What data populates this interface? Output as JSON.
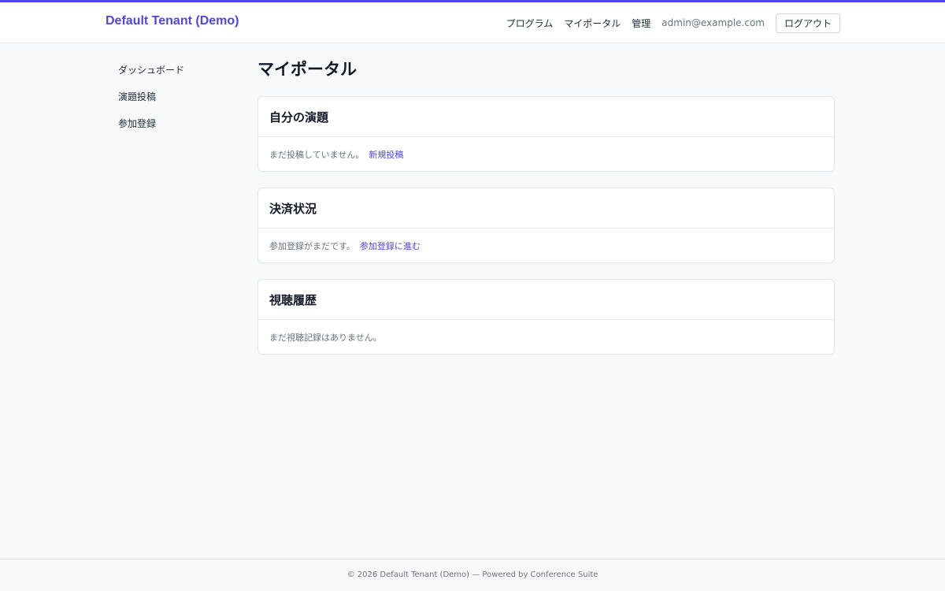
{
  "header": {
    "brand": "Default Tenant (Demo)",
    "nav": {
      "program": "プログラム",
      "my_portal": "マイポータル",
      "admin": "管理"
    },
    "user_email": "admin@example.com",
    "logout_label": "ログアウト",
    "accent_color": "#4f46e5"
  },
  "sidebar": {
    "items": [
      {
        "label": "ダッシュボード"
      },
      {
        "label": "演題投稿"
      },
      {
        "label": "参加登録"
      }
    ]
  },
  "main": {
    "title": "マイポータル",
    "cards": [
      {
        "title": "自分の演題",
        "text": "まだ投稿していません。",
        "link": "新規投稿"
      },
      {
        "title": "決済状況",
        "text": "参加登録がまだです。",
        "link": "参加登録に進む"
      },
      {
        "title": "視聴履歴",
        "text": "まだ視聴記録はありません。"
      }
    ]
  },
  "footer": {
    "text": "© 2026 Default Tenant (Demo) — Powered by Conference Suite"
  }
}
